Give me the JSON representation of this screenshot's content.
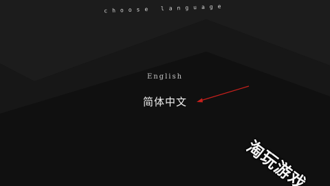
{
  "screen": {
    "title": "choose language",
    "options": [
      {
        "label": "English"
      },
      {
        "label": "简体中文"
      }
    ]
  },
  "annotation": {
    "arrow_color": "#c8201c"
  },
  "watermark": {
    "text": "淘玩游戏"
  },
  "colors": {
    "background": "#121212",
    "text": "#e6e6e6"
  }
}
